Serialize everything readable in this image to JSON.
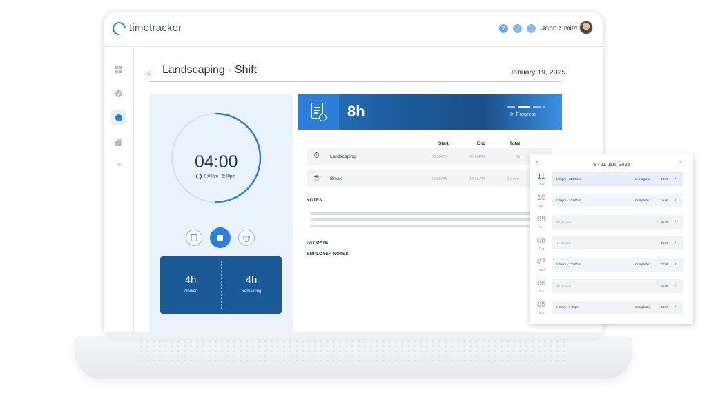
{
  "app": {
    "name": "timetracker",
    "brand_color": "#2d7ed8"
  },
  "topbar": {
    "help_icon": "?",
    "user_name": "John Smith"
  },
  "sidebar": {
    "items": [
      "dashboard-icon",
      "check-icon",
      "clock-icon",
      "documents-icon",
      "more-icon"
    ],
    "more_glyph": "•••"
  },
  "page": {
    "back_glyph": "‹",
    "title": "Landscaping - Shift",
    "date": "January 19, 2025"
  },
  "timer": {
    "value": "04:00",
    "range": "9:00am - 5:00pm",
    "progress_fraction": 0.5
  },
  "stats": [
    {
      "value": "4h",
      "label": "Worked"
    },
    {
      "value": "4h",
      "label": "Remaining"
    }
  ],
  "shift": {
    "total": "8h",
    "status": "In Progress"
  },
  "entries": {
    "columns": [
      "Start",
      "End",
      "Total"
    ],
    "rows": [
      {
        "icon": "stopwatch-icon",
        "glyph": "⏱",
        "name": "Landscaping",
        "start": "09:00AM",
        "end": "05:00PM",
        "total": "8h"
      },
      {
        "icon": "coffee-icon",
        "glyph": "☕",
        "name": "Break",
        "start": "10:00AM",
        "end": "10:15AM",
        "total": "15 min"
      }
    ]
  },
  "sections": {
    "notes": "NOTES",
    "pay_date": "PAY DATE",
    "employer_notes": "EMPLOYER NOTES"
  },
  "week": {
    "range": "5 - 11 Jan, 2025",
    "prev_glyph": "‹",
    "next_glyph": "›",
    "days": [
      {
        "num": "11",
        "dow": "Sun",
        "time": "6:00pm - 11:59pm",
        "status": "In progress",
        "hours": "06:00"
      },
      {
        "num": "10",
        "dow": "Sat",
        "time": "6:00pm - 10:00pm",
        "status": "Completed",
        "hours": "04:00"
      },
      {
        "num": "09",
        "dow": "Fri",
        "time": "No Record",
        "status": "",
        "hours": "00:00"
      },
      {
        "num": "08",
        "dow": "Thu",
        "time": "No Record",
        "status": "",
        "hours": "00:00"
      },
      {
        "num": "07",
        "dow": "Wed",
        "time": "9:00am - 12:00pm",
        "status": "Completed",
        "hours": "03:00"
      },
      {
        "num": "06",
        "dow": "Tue",
        "time": "No Record",
        "status": "",
        "hours": "00:00"
      },
      {
        "num": "05",
        "dow": "Mon",
        "time": "5:00am - 5:00pm",
        "status": "Completed",
        "hours": "06:00"
      }
    ]
  }
}
